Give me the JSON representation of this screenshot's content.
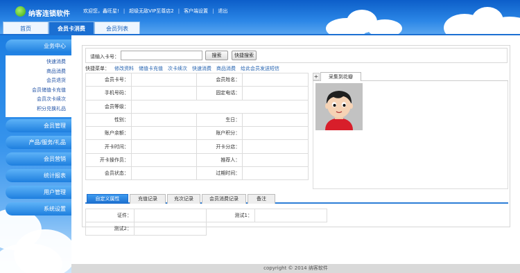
{
  "app": {
    "title": "纳客连锁软件"
  },
  "topbar": {
    "welcome": "欢迎您，鑫旺星!",
    "vip": "超级无敌VIP至尊店2",
    "customer_settings": "客户端设置",
    "logout": "退出"
  },
  "tabs": [
    {
      "label": "首页"
    },
    {
      "label": "会员卡消费"
    },
    {
      "label": "会员列表"
    }
  ],
  "sidebar": {
    "business_center": "业务中心",
    "sub_items": [
      "快速消费",
      "商品消费",
      "会员退货",
      "会员储值卡充值",
      "会员次卡续次",
      "积分兑换礼品"
    ],
    "sections": [
      "会员管理",
      "产品/服务/礼品",
      "会员营销",
      "统计报表",
      "用户管理",
      "系统设置"
    ]
  },
  "search": {
    "card_label": "请输入卡号：",
    "card_value": "",
    "search_btn": "搜索",
    "quick_search_btn": "快捷搜索"
  },
  "quick_menu": {
    "label": "快捷菜单：",
    "links": [
      "修改资料",
      "储值卡充值",
      "次卡续次",
      "快速消费",
      "商品消费",
      "给此会员发送短信"
    ]
  },
  "member_fields": {
    "card_no": "会员卡号：",
    "name": "会员姓名：",
    "phone": "手机号码：",
    "tel": "固定电话：",
    "level": "会员等级：",
    "gender": "性别：",
    "birthday": "生日：",
    "balance": "账户余额：",
    "points": "账户积分：",
    "open_time": "开卡时间：",
    "open_store": "开卡分店：",
    "operator": "开卡操作员：",
    "referrer": "推荐人：",
    "status": "会员状态：",
    "expire": "过期时间："
  },
  "photo": {
    "plus": "+",
    "tab_label": "采集到花瓣"
  },
  "bottom_tabs": [
    "自定义属性",
    "充值记录",
    "充次记录",
    "会员消费记录",
    "备注"
  ],
  "custom_attrs": {
    "certificate": "证件：",
    "test1": "测试1：",
    "test2": "测试2："
  },
  "footer": {
    "copyright": "copyright © 2014 纳客软件"
  }
}
